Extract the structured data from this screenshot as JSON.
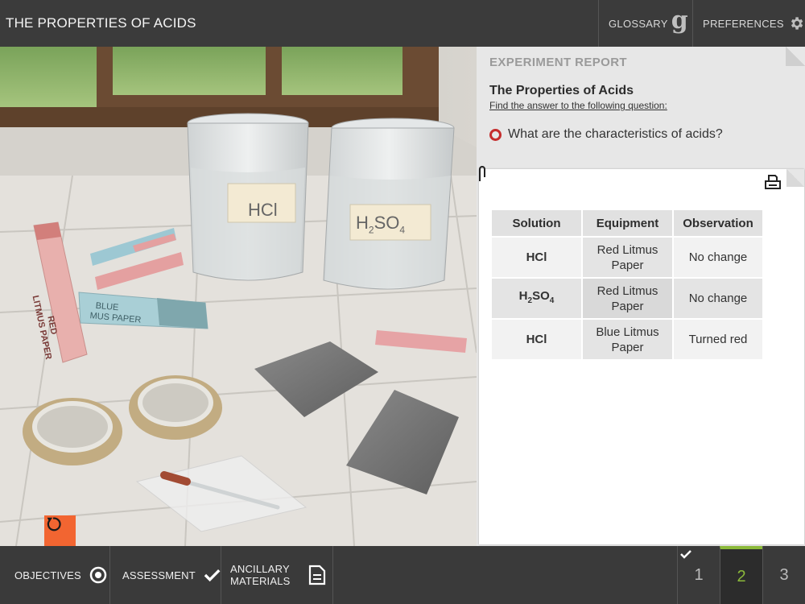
{
  "header": {
    "title": "THE PROPERTIES OF ACIDS",
    "glossary_label": "GLOSSARY",
    "preferences_label": "PREFERENCES"
  },
  "scene": {
    "beaker1_label": "HCl",
    "beaker2_label": "H",
    "beaker2_sub1": "2",
    "beaker2_mid": "SO",
    "beaker2_sub2": "4",
    "red_paper_label_1": "RED",
    "red_paper_label_2": "LITMUS PAPER",
    "blue_paper_label_1": "BLUE",
    "blue_paper_label_2": "MUS PAPER"
  },
  "report": {
    "heading": "EXPERIMENT REPORT",
    "title": "The Properties of Acids",
    "subtitle": "Find the answer to the following question:",
    "question": "What are the characteristics of acids?",
    "table": {
      "headers": [
        "Solution",
        "Equipment",
        "Observation"
      ],
      "rows": [
        {
          "solution": "HCl",
          "equipment": "Red Litmus Paper",
          "observation": "No change"
        },
        {
          "solution_main": "H",
          "solution_sub1": "2",
          "solution_mid": "SO",
          "solution_sub2": "4",
          "equipment": "Red Litmus Paper",
          "observation": "No change"
        },
        {
          "solution": "HCl",
          "equipment": "Blue Litmus Paper",
          "observation": "Turned red"
        }
      ]
    }
  },
  "footer": {
    "objectives_label": "OBJECTIVES",
    "assessment_label": "ASSESSMENT",
    "ancillary_label_1": "ANCILLARY",
    "ancillary_label_2": "MATERIALS",
    "pages": [
      "1",
      "2",
      "3"
    ],
    "current_page": "2"
  },
  "colors": {
    "accent_orange": "#f26531",
    "active_green": "#8bb93a",
    "bullet_red": "#c52d2d"
  }
}
